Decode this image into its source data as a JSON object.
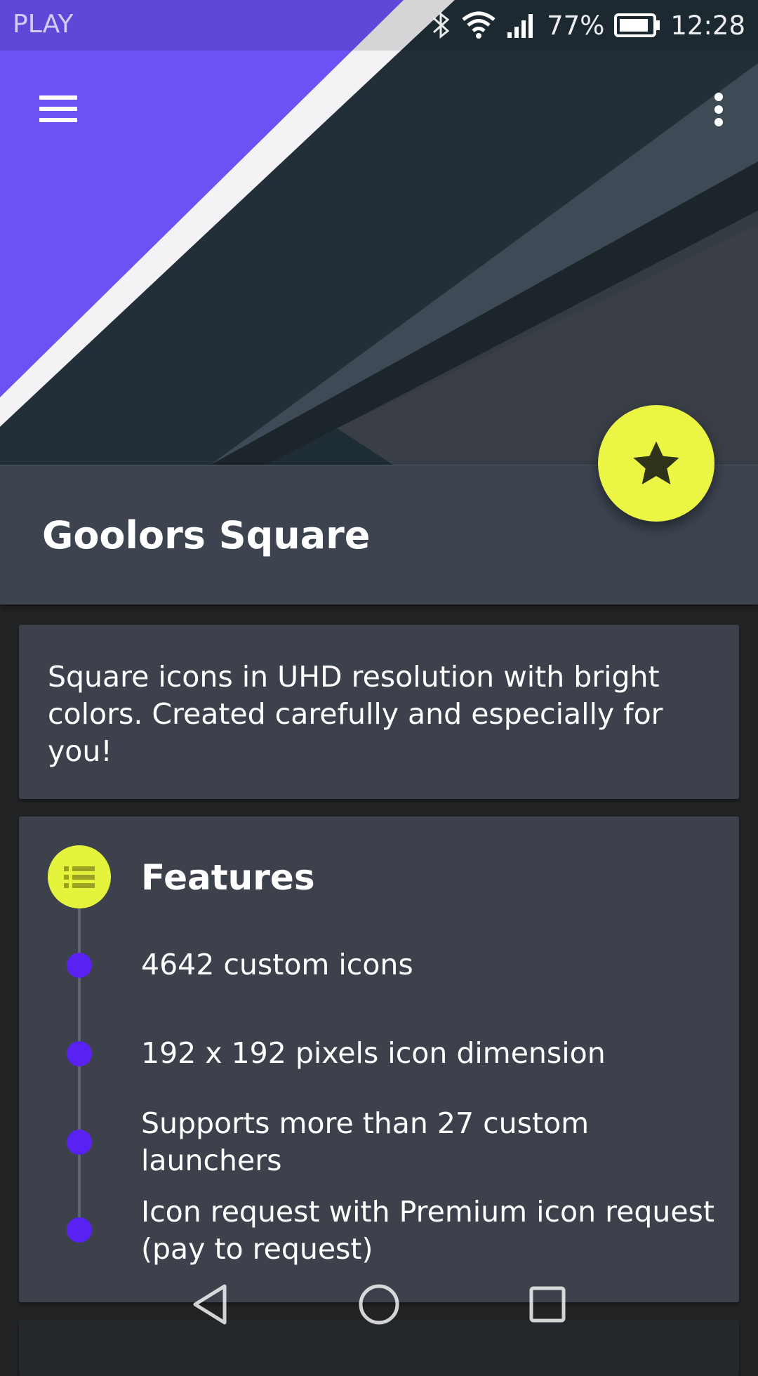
{
  "status_bar": {
    "carrier": "PLAY",
    "battery": "77%",
    "time": "12:28",
    "icons": [
      "bluetooth-icon",
      "wifi-icon",
      "signal-icon",
      "battery-icon"
    ]
  },
  "app_bar": {
    "menu_icon": "hamburger-menu-icon",
    "overflow_icon": "more-vert-icon"
  },
  "header": {
    "title": "Goolors Square",
    "fab_icon": "star-icon",
    "colors": {
      "accent": "#eaf643",
      "purple": "#6b52f5",
      "band": "#3d4450"
    }
  },
  "description": {
    "text": "Square icons in UHD resolution with bright colors. Created carefully and especially for you!"
  },
  "features": {
    "icon": "list-icon",
    "title": "Features",
    "items": [
      "4642 custom icons",
      "192 x 192 pixels icon dimension",
      "Supports more than 27 custom launchers",
      "Icon request with Premium icon request (pay to request)"
    ]
  },
  "nav_bar": {
    "icons": [
      "back-icon",
      "home-icon",
      "recents-icon"
    ]
  }
}
